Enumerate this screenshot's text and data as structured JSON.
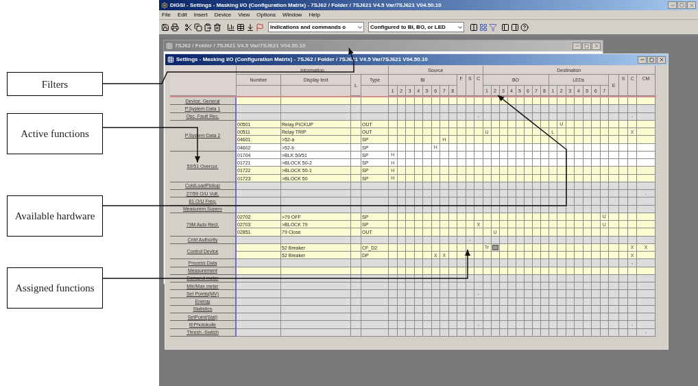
{
  "app": {
    "title": "DIGSI - Settings - Masking I/O (Configuration Matrix) - 7SJ62 / Folder / 7SJ621 V4.5 Var/7SJ621 V04.50.10",
    "menu": [
      "File",
      "Edit",
      "Insert",
      "Device",
      "View",
      "Options",
      "Window",
      "Help"
    ],
    "toolbar": {
      "filter_indications": "Indications and commands o",
      "filter_configured": "Configured to BI, BO, or LED"
    }
  },
  "device_window": {
    "title": "7SJ62 / Folder / 7SJ621 V4.5 Var/7SJ621 V04.50.10"
  },
  "matrix_window": {
    "title": "Settings - Masking I/O (Configuration Matrix) - 7SJ62 / Folder / 7SJ621 V4.5 Var/7SJ621 V04.50.10",
    "header": {
      "information": "Information",
      "source": "Source",
      "destination": "Destination",
      "number": "Number",
      "display_text": "Display text",
      "l": "L",
      "type": "Type",
      "bi": "BI",
      "bi_columns": [
        "1",
        "2",
        "3",
        "4",
        "5",
        "6",
        "7",
        "8"
      ],
      "f": "F",
      "s": "S",
      "c": "C",
      "bo": "BO",
      "bo_columns": [
        "1",
        "2",
        "3",
        "4",
        "5",
        "6",
        "7",
        "8"
      ],
      "leds": "LEDs",
      "led_columns": [
        "1",
        "2",
        "3",
        "4",
        "5",
        "6",
        "7"
      ],
      "e": "E",
      "s_dest": "S",
      "c_dest": "C",
      "cm": "CM"
    },
    "groups": [
      {
        "name": "Device, General",
        "rows": [
          {
            "kind": "yellow"
          }
        ]
      },
      {
        "name": "P.System Data 1",
        "rows": [
          {
            "kind": "gray"
          }
        ]
      },
      {
        "name": "Osc. Fault Rec.",
        "rows": [
          {
            "kind": "gray",
            "marks": [
              {
                "kind": "c",
                "text": "-"
              },
              {
                "kind": "c_dest",
                "text": "-"
              }
            ]
          }
        ]
      },
      {
        "name": "P.System Data 2",
        "rows": [
          {
            "kind": "yellow",
            "number": "00501",
            "text": "Relay PICKUP",
            "type": "OUT",
            "marks": [
              {
                "kind": "led2",
                "text": "U"
              }
            ]
          },
          {
            "kind": "yellow",
            "number": "00511",
            "text": "Relay TRIP",
            "type": "OUT",
            "marks": [
              {
                "kind": "bo1",
                "text": "U"
              },
              {
                "kind": "led1",
                "text": "L"
              },
              {
                "kind": "c_dest",
                "text": "X"
              }
            ]
          },
          {
            "kind": "yellow",
            "number": "04601",
            "text": ">52-a",
            "type": "SP",
            "marks": [
              {
                "kind": "bi7",
                "text": "H"
              }
            ]
          },
          {
            "kind": "white",
            "number": "04602",
            "text": ">52-b",
            "type": "SP",
            "marks": [
              {
                "kind": "bi6",
                "text": "H"
              }
            ]
          }
        ]
      },
      {
        "name": "50/51 Overcur.",
        "rows": [
          {
            "kind": "white",
            "number": "01704",
            "text": ">BLK 50/51",
            "type": "SP",
            "marks": [
              {
                "kind": "bi1",
                "text": "H"
              }
            ]
          },
          {
            "kind": "white",
            "number": "01721",
            "text": ">BLOCK 50-2",
            "type": "SP",
            "marks": [
              {
                "kind": "bi1",
                "text": "H"
              }
            ]
          },
          {
            "kind": "yellow",
            "number": "01722",
            "text": ">BLOCK 50-1",
            "type": "SP",
            "marks": [
              {
                "kind": "bi1",
                "text": "H"
              }
            ]
          },
          {
            "kind": "yellow",
            "number": "01723",
            "text": ">BLOCK 50",
            "type": "SP",
            "marks": [
              {
                "kind": "bi1",
                "text": "H"
              }
            ]
          }
        ]
      },
      {
        "name": "ColdLoadPickup",
        "rows": [
          {
            "kind": "gray"
          }
        ]
      },
      {
        "name": "27/59 O/U Volt.",
        "rows": [
          {
            "kind": "gray",
            "marks": [
              {
                "kind": "cm",
                "text": "-"
              }
            ]
          }
        ]
      },
      {
        "name": "81 O/U Freq.",
        "rows": [
          {
            "kind": "gray"
          }
        ]
      },
      {
        "name": "Measurem.Superv",
        "rows": [
          {
            "kind": "gray"
          }
        ]
      },
      {
        "name": "79M Auto Recl.",
        "rows": [
          {
            "kind": "yellow",
            "number": "02702",
            "text": ">79 OFF",
            "type": "SP",
            "marks": [
              {
                "kind": "led7",
                "text": "U"
              }
            ]
          },
          {
            "kind": "yellow",
            "number": "02703",
            "text": ">BLOCK 79",
            "type": "SP",
            "marks": [
              {
                "kind": "c",
                "text": "X"
              },
              {
                "kind": "led7",
                "text": "U"
              }
            ]
          },
          {
            "kind": "yellow",
            "number": "02851",
            "text": "79 Close",
            "type": "OUT",
            "marks": [
              {
                "kind": "bo2",
                "text": "U"
              }
            ]
          }
        ]
      },
      {
        "name": "Cntrl Authority",
        "rows": [
          {
            "kind": "gray",
            "marks": [
              {
                "kind": "s",
                "text": "-"
              }
            ]
          }
        ]
      },
      {
        "name": "Control Device",
        "rows": [
          {
            "kind": "yellow",
            "text": "52 Breaker",
            "type": "CF_D2",
            "marks": [
              {
                "kind": "bo1",
                "text": "Tr"
              },
              {
                "kind": "bo2",
                "box": true
              },
              {
                "kind": "c_dest",
                "text": "X"
              },
              {
                "kind": "cm",
                "text": "X"
              }
            ]
          },
          {
            "kind": "yellow",
            "text": "52 Breaker",
            "type": "DP",
            "marks": [
              {
                "kind": "bi6",
                "text": "X"
              },
              {
                "kind": "bi7",
                "text": "X"
              },
              {
                "kind": "c_dest",
                "text": "X"
              }
            ]
          }
        ]
      },
      {
        "name": "Process Data",
        "rows": [
          {
            "kind": "gray",
            "marks": [
              {
                "kind": "c_dest",
                "text": "-"
              }
            ]
          }
        ]
      },
      {
        "name": "Measurement",
        "rows": [
          {
            "kind": "yellow"
          }
        ]
      },
      {
        "name": "Demand meter",
        "rows": [
          {
            "kind": "gray"
          }
        ]
      },
      {
        "name": "Min/Max meter",
        "rows": [
          {
            "kind": "gray"
          }
        ]
      },
      {
        "name": "Set Points(MV)",
        "rows": [
          {
            "kind": "gray",
            "marks": [
              {
                "kind": "c",
                "text": "-"
              }
            ]
          }
        ]
      },
      {
        "name": "Energy",
        "rows": [
          {
            "kind": "gray"
          }
        ]
      },
      {
        "name": "Statistics",
        "rows": [
          {
            "kind": "gray"
          }
        ]
      },
      {
        "name": "SetPoint(Stat)",
        "rows": [
          {
            "kind": "gray"
          }
        ]
      },
      {
        "name": "IEPhotokolle",
        "rows": [
          {
            "kind": "gray",
            "marks": [
              {
                "kind": "c",
                "text": "-"
              },
              {
                "kind": "c_dest",
                "text": "-"
              }
            ]
          }
        ]
      },
      {
        "name": "Thresh.-Switch",
        "rows": [
          {
            "kind": "gray",
            "marks": [
              {
                "kind": "cm",
                "text": "-"
              }
            ]
          }
        ]
      }
    ]
  },
  "callouts": [
    {
      "text": "Filters"
    },
    {
      "text": "Active functions"
    },
    {
      "text": "Available hardware"
    },
    {
      "text": "Assigned functions"
    }
  ]
}
